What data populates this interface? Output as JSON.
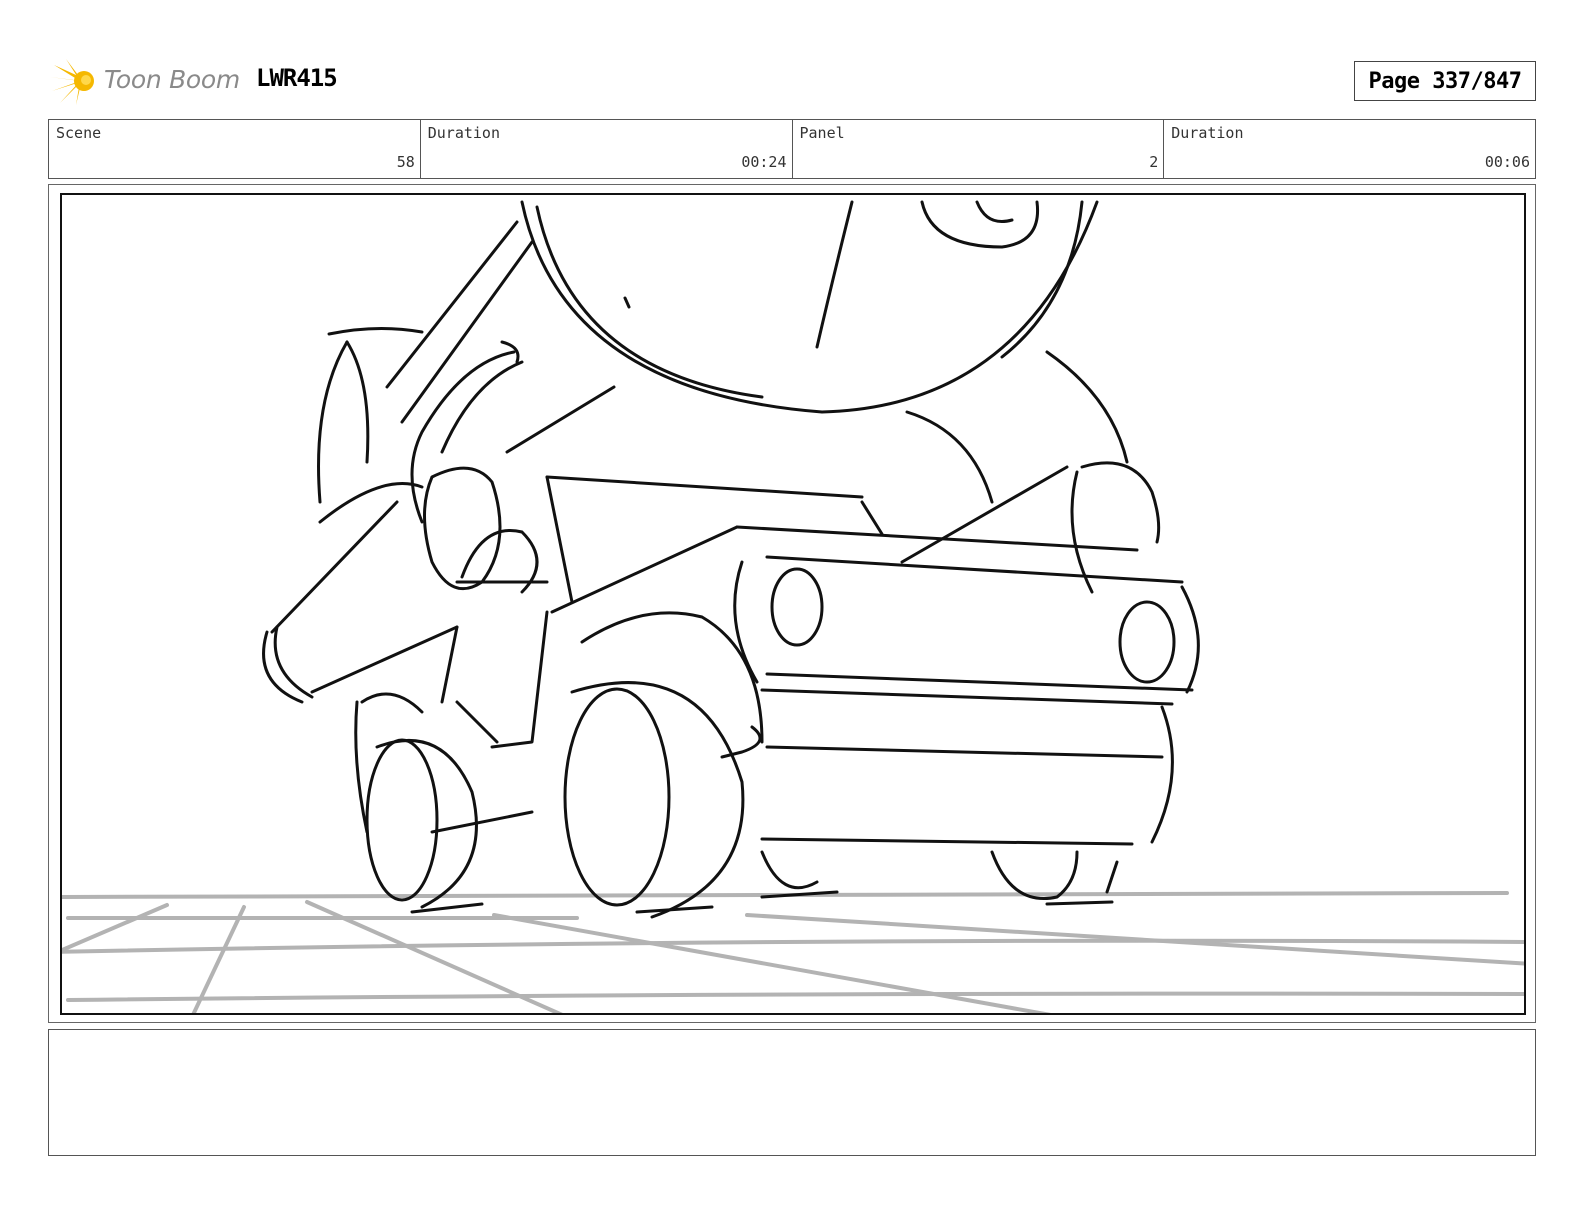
{
  "header": {
    "logo_text": "Toon Boom",
    "project_code": "LWR415",
    "page": "Page 337/847"
  },
  "info": {
    "scene_label": "Scene",
    "scene_value": "58",
    "scene_duration_label": "Duration",
    "scene_duration_value": "00:24",
    "panel_label": "Panel",
    "panel_value": "2",
    "panel_duration_label": "Duration",
    "panel_duration_value": "00:06"
  },
  "caption": ""
}
